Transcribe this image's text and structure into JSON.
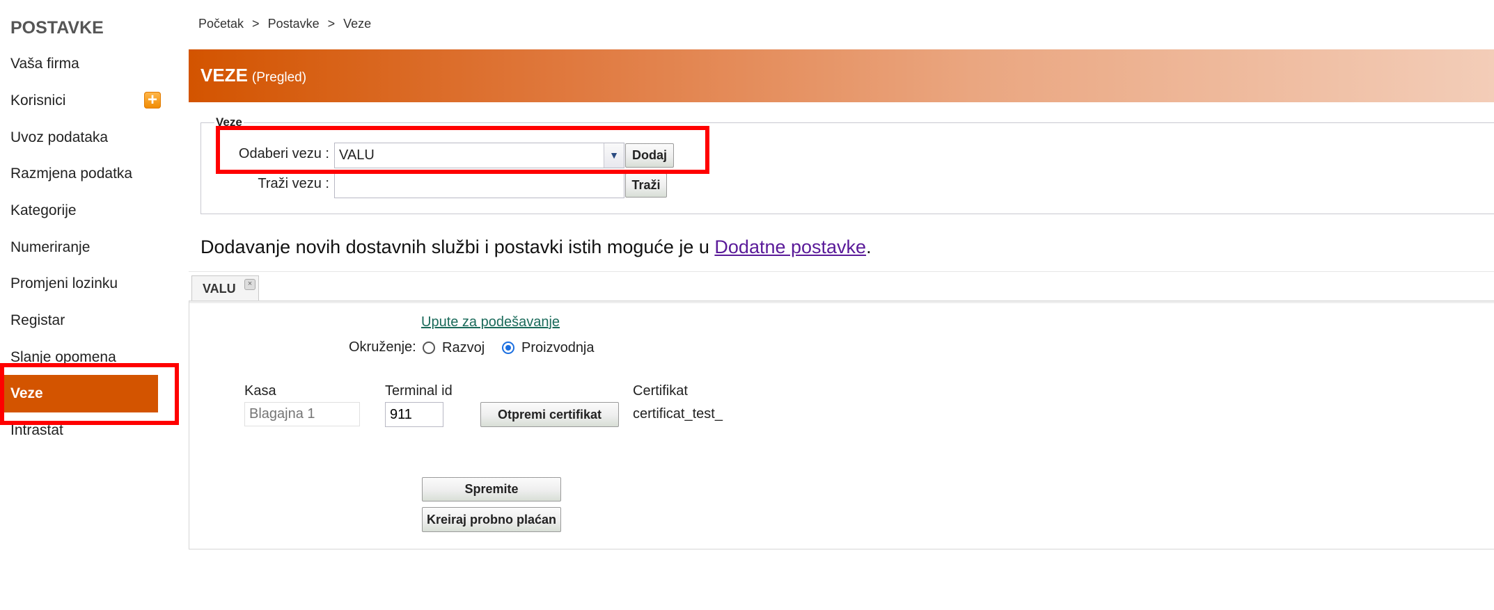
{
  "sidebar": {
    "title": "POSTAVKE",
    "items": [
      {
        "label": "Vaša firma"
      },
      {
        "label": "Korisnici"
      },
      {
        "label": "Uvoz podataka"
      },
      {
        "label": "Razmjena podatka"
      },
      {
        "label": "Kategorije"
      },
      {
        "label": "Numeriranje"
      },
      {
        "label": "Promjeni lozinku"
      },
      {
        "label": "Registar"
      },
      {
        "label": "Slanje opomena"
      },
      {
        "label": "Veze"
      },
      {
        "label": "Intrastat"
      }
    ],
    "plus_icon": "plus-icon",
    "active_color": "#d35400"
  },
  "breadcrumb": [
    "Početak",
    "Postavke",
    "Veze"
  ],
  "breadcrumb_sep": ">",
  "header": {
    "title": "VEZE",
    "subtitle": "(Pregled)"
  },
  "veze_form": {
    "legend": "Veze",
    "select_label": "Odaberi vezu :",
    "select_value": "VALU",
    "add_button": "Dodaj",
    "search_label": "Traži vezu :",
    "search_value": "",
    "search_button": "Traži"
  },
  "info": {
    "text": "Dodavanje novih dostavnih službi i postavki istih moguće je u ",
    "link": "Dodatne postavke",
    "suffix": "."
  },
  "tab": {
    "label": "VALU"
  },
  "panel": {
    "guide_link": "Upute za podešavanje",
    "env_label": "Okruženje:",
    "env_options": [
      {
        "label": "Razvoj",
        "checked": false
      },
      {
        "label": "Proizvodnja",
        "checked": true
      }
    ],
    "kasa_label": "Kasa",
    "kasa_placeholder": "Blagajna 1",
    "terminal_label": "Terminal id",
    "terminal_value": "911",
    "upload_button": "Otpremi certifikat",
    "cert_label": "Certifikat",
    "cert_value": "certificat_test_",
    "save_button": "Spremite",
    "test_button": "Kreiraj probno plaćan"
  }
}
